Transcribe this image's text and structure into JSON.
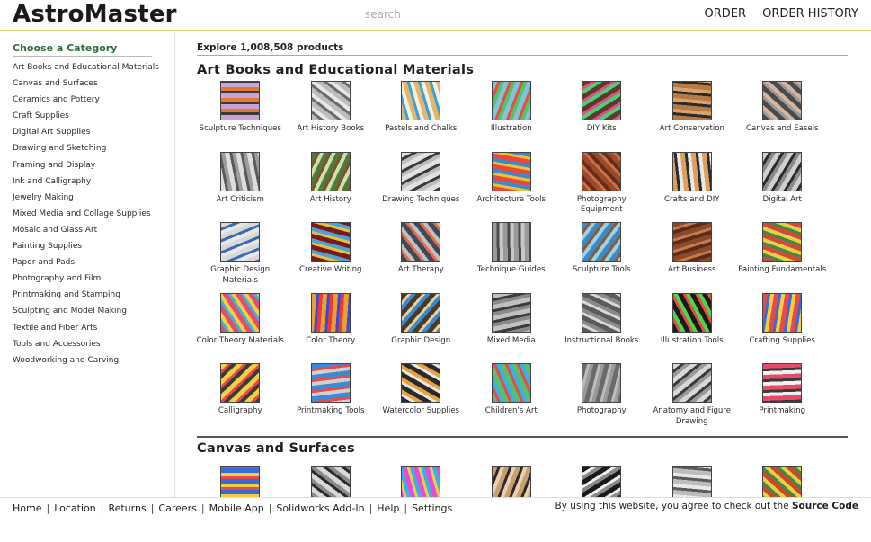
{
  "header": {
    "logo": "AstroMaster",
    "search_placeholder": "search",
    "nav": [
      "ORDER",
      "ORDER HISTORY"
    ]
  },
  "sidebar": {
    "title": "Choose a Category",
    "items": [
      "Art Books and Educational Materials",
      "Canvas and Surfaces",
      "Ceramics and Pottery",
      "Craft Supplies",
      "Digital Art Supplies",
      "Drawing and Sketching",
      "Framing and Display",
      "Ink and Calligraphy",
      "Jewelry Making",
      "Mixed Media and Collage Supplies",
      "Mosaic and Glass Art",
      "Painting Supplies",
      "Paper and Pads",
      "Photography and Film",
      "Printmaking and Stamping",
      "Sculpting and Model Making",
      "Textile and Fiber Arts",
      "Tools and Accessories",
      "Woodworking and Carving"
    ]
  },
  "main": {
    "explore": "Explore 1,008,508 products",
    "section1_title": "Art Books and Educational Materials",
    "section1_items": [
      {
        "label": "Sculpture Techniques",
        "colors": [
          "#c9a3d8",
          "#3a3a3a",
          "#e07a30"
        ]
      },
      {
        "label": "Art History Books",
        "colors": [
          "#bdbdbd",
          "#6a6a6a",
          "#e8e8e8"
        ]
      },
      {
        "label": "Pastels and Chalks",
        "colors": [
          "#e8b46a",
          "#3aa0d8",
          "#f2f0e0"
        ]
      },
      {
        "label": "Illustration",
        "colors": [
          "#7fc4d9",
          "#e74c3c",
          "#58c06a"
        ]
      },
      {
        "label": "DIY Kits",
        "colors": [
          "#5a3b26",
          "#e64c8a",
          "#4cd07a"
        ]
      },
      {
        "label": "Art Conservation",
        "colors": [
          "#b57a45",
          "#2a2a2a",
          "#d9a46c"
        ]
      },
      {
        "label": "Canvas and Easels",
        "colors": [
          "#4a4a4a",
          "#9a9a9a",
          "#d6b4a0"
        ]
      },
      {
        "label": "Art Criticism",
        "colors": [
          "#dedede",
          "#5a5a5a",
          "#9c9c9c"
        ]
      },
      {
        "label": "Art History",
        "colors": [
          "#4f7a3a",
          "#7a5230",
          "#cfe0b0"
        ]
      },
      {
        "label": "Drawing Techniques",
        "colors": [
          "#e2e2e2",
          "#3a3a3a",
          "#bdbdbd"
        ]
      },
      {
        "label": "Architecture Tools",
        "colors": [
          "#e84a3a",
          "#f0c030",
          "#3a8ad0"
        ]
      },
      {
        "label": "Photography Equipment",
        "colors": [
          "#9a4a2a",
          "#c8704a",
          "#6a2a1a"
        ]
      },
      {
        "label": "Crafts and DIY",
        "colors": [
          "#d9a060",
          "#2a2a2a",
          "#e8e8e8"
        ]
      },
      {
        "label": "Digital Art",
        "colors": [
          "#cfcfcf",
          "#2a2a2a",
          "#8a8a8a"
        ]
      },
      {
        "label": "Graphic Design Materials",
        "colors": [
          "#d8d8d8",
          "#3a6ab0",
          "#e8e8e8"
        ]
      },
      {
        "label": "Creative Writing",
        "colors": [
          "#7a1a1a",
          "#e8c040",
          "#50a0d8"
        ]
      },
      {
        "label": "Art Therapy",
        "colors": [
          "#3a4a5a",
          "#e86a4a",
          "#c0c0c0"
        ]
      },
      {
        "label": "Technique Guides",
        "colors": [
          "#9a9a9a",
          "#4a4a4a",
          "#c8c8c8"
        ]
      },
      {
        "label": "Sculpture Tools",
        "colors": [
          "#3a8ac8",
          "#8a5a30",
          "#a0d0e8"
        ]
      },
      {
        "label": "Art Business",
        "colors": [
          "#8a4a2a",
          "#c87a4a",
          "#5a2a1a"
        ]
      },
      {
        "label": "Painting Fundamentals",
        "colors": [
          "#d04a3a",
          "#3a8a4a",
          "#e8d040"
        ]
      },
      {
        "label": "Color Theory Materials",
        "colors": [
          "#e84a6a",
          "#3ab0e8",
          "#f0d040"
        ]
      },
      {
        "label": "Color Theory",
        "colors": [
          "#e8a030",
          "#3a4ad8",
          "#e83a3a"
        ]
      },
      {
        "label": "Graphic Design",
        "colors": [
          "#4a3a2a",
          "#e8d0a0",
          "#3a8ad0"
        ]
      },
      {
        "label": "Mixed Media",
        "colors": [
          "#c0c0c0",
          "#3a3a3a",
          "#8a8a8a"
        ]
      },
      {
        "label": "Instructional Books",
        "colors": [
          "#5a5a5a",
          "#d8d8d8",
          "#8a8a8a"
        ]
      },
      {
        "label": "Illustration Tools",
        "colors": [
          "#1a1a1a",
          "#e84a4a",
          "#4ad84a"
        ]
      },
      {
        "label": "Crafting Supplies",
        "colors": [
          "#e84a4a",
          "#3a6ad8",
          "#f0d040"
        ]
      },
      {
        "label": "Calligraphy",
        "colors": [
          "#f0d040",
          "#e84a4a",
          "#3a3a3a"
        ]
      },
      {
        "label": "Printmaking Tools",
        "colors": [
          "#3a8ad8",
          "#e84a4a",
          "#d0d0d0"
        ]
      },
      {
        "label": "Watercolor Supplies",
        "colors": [
          "#2a2a2a",
          "#e8e8e8",
          "#e8a040"
        ]
      },
      {
        "label": "Children's Art",
        "colors": [
          "#58c06a",
          "#e84a4a",
          "#3ab0e8"
        ]
      },
      {
        "label": "Photography",
        "colors": [
          "#6a6a6a",
          "#bdbdbd",
          "#9a9a9a"
        ]
      },
      {
        "label": "Anatomy and Figure Drawing",
        "colors": [
          "#d8d8d8",
          "#3a3a3a",
          "#9a9a9a"
        ]
      },
      {
        "label": "Printmaking",
        "colors": [
          "#e84a6a",
          "#3a3a3a",
          "#f0f0f0"
        ]
      }
    ],
    "section2_title": "Canvas and Surfaces",
    "section2_items": [
      {
        "label": "",
        "colors": [
          "#3a6ad8",
          "#e84a4a",
          "#f0d040"
        ]
      },
      {
        "label": "",
        "colors": [
          "#d8d8d8",
          "#2a2a2a",
          "#8a8a8a"
        ]
      },
      {
        "label": "",
        "colors": [
          "#e84ad8",
          "#f0d040",
          "#3ab0e8"
        ]
      },
      {
        "label": "",
        "colors": [
          "#c8a070",
          "#2a2a2a",
          "#e8d0b0"
        ]
      },
      {
        "label": "",
        "colors": [
          "#1a1a1a",
          "#f0f0f0",
          "#8a8a8a"
        ]
      },
      {
        "label": "",
        "colors": [
          "#bdbdbd",
          "#5a5a5a",
          "#e8e8e8"
        ]
      },
      {
        "label": "",
        "colors": [
          "#c84a2a",
          "#3a8a4a",
          "#e8d040"
        ]
      }
    ]
  },
  "footer": {
    "links": [
      "Home",
      "Location",
      "Returns",
      "Careers",
      "Mobile App",
      "Solidworks Add-In",
      "Help",
      "Settings"
    ],
    "note_prefix": "By using this website, you agree to check out the",
    "note_link": "Source Code"
  }
}
